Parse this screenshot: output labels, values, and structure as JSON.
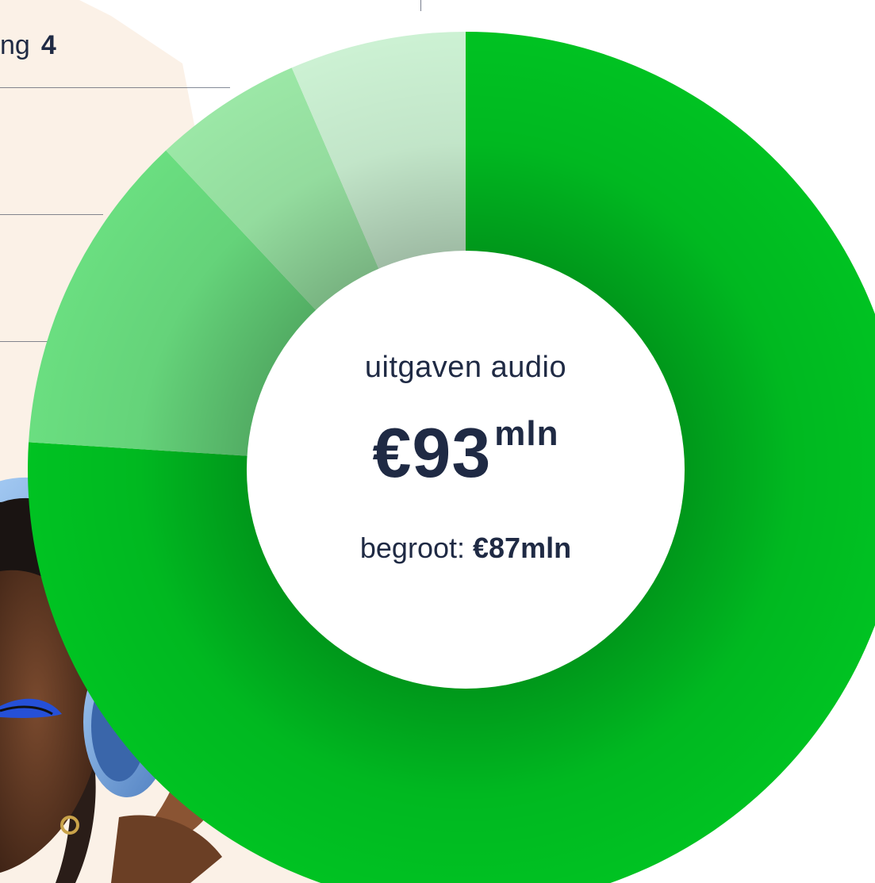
{
  "row": {
    "label_fragment": "ng",
    "number": "4"
  },
  "chart_data": {
    "type": "pie",
    "variant": "donut",
    "segments": [
      {
        "share": 0.76,
        "color": "#00c222"
      },
      {
        "share": 0.12,
        "color": "#6ade80"
      },
      {
        "share": 0.055,
        "color": "#9be7a6"
      },
      {
        "share": 0.065,
        "color": "#ccf1d3"
      }
    ],
    "center": {
      "caption": "uitgaven audio",
      "value": "€93",
      "value_unit": "mln",
      "budget_label": "begroot:",
      "budget_value": "€87mln"
    }
  },
  "colors": {
    "background_panel": "#fbf1e7",
    "text": "#1f2a44"
  }
}
